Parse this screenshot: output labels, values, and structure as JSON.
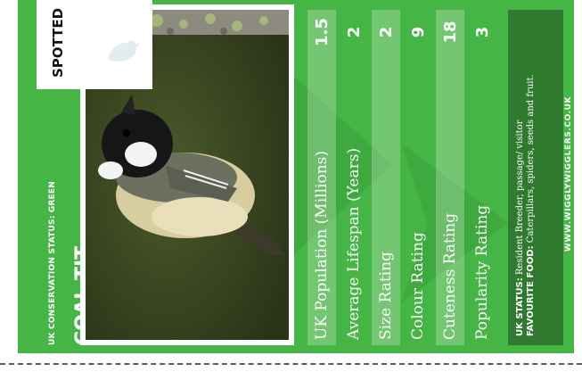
{
  "card": {
    "conservation_status": "UK CONSERVATION STATUS: GREEN",
    "bird_name": "COAL TIT",
    "spotted_label": "SPOTTED",
    "stats": [
      {
        "label": "UK Population (Millions)",
        "value": "1.5"
      },
      {
        "label": "Average Lifespan (Years)",
        "value": "2"
      },
      {
        "label": "Size Rating",
        "value": "2"
      },
      {
        "label": "Colour Rating",
        "value": "9"
      },
      {
        "label": "Cuteness Rating",
        "value": "18"
      },
      {
        "label": "Popularity Rating",
        "value": "3"
      }
    ],
    "info": {
      "uk_status_key": "UK STATUS:",
      "uk_status_value": "Resident Breeder, passage/ visitor",
      "food_key": "FAVOURITE FOOD:",
      "food_value": "Caterpillars, spiders, seeds and fruit."
    },
    "website": "WWW.WIGGLYWIGGLERS.CO.UK"
  },
  "colors": {
    "card_green": "#45b545",
    "info_box_green": "#2f7a2f",
    "stat_row_highlight": "rgba(255,255,255,0.25)"
  },
  "icons": {
    "spotted": "bird-silhouette-icon",
    "decoration": "arrow-watermark-icon"
  }
}
